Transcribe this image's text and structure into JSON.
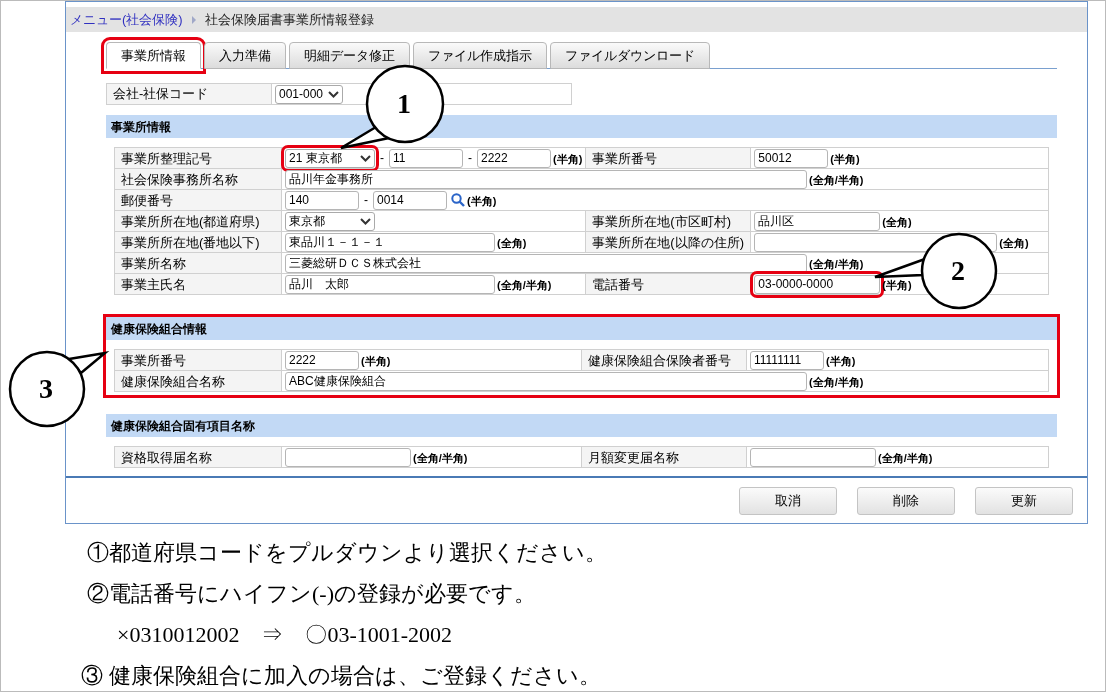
{
  "breadcrumb": {
    "link": "メニュー(社会保険)",
    "current": "社会保険届書事業所情報登録"
  },
  "tabs": [
    {
      "label": "事業所情報",
      "selected": true,
      "highlighted": true
    },
    {
      "label": "入力準備",
      "selected": false,
      "highlighted": false
    },
    {
      "label": "明細データ修正",
      "selected": false,
      "highlighted": false
    },
    {
      "label": "ファイル作成指示",
      "selected": false,
      "highlighted": false
    },
    {
      "label": "ファイルダウンロード",
      "selected": false,
      "highlighted": false
    }
  ],
  "company_code": {
    "label": "会社-社保コード",
    "value": "001-000"
  },
  "sections": [
    {
      "title": "事業所情報",
      "highlighted": false,
      "rows": [
        {
          "cells": [
            {
              "label": "事業所整理記号",
              "items": [
                {
                  "kind": "select",
                  "value": "21 東京都",
                  "highlighted": true
                },
                {
                  "kind": "sep",
                  "text": "-"
                },
                {
                  "kind": "short-input",
                  "value": "11"
                },
                {
                  "kind": "sep",
                  "text": "-"
                },
                {
                  "kind": "short-input",
                  "value": "2222"
                },
                {
                  "kind": "hint",
                  "text": "(半角)"
                }
              ]
            },
            {
              "label": "事業所番号",
              "items": [
                {
                  "kind": "short-input",
                  "value": "50012"
                },
                {
                  "kind": "hint",
                  "text": "(半角)"
                }
              ]
            }
          ]
        },
        {
          "cells": [
            {
              "label": "社会保険事務所名称",
              "items": [
                {
                  "kind": "full-input",
                  "value": "品川年金事務所"
                },
                {
                  "kind": "hint",
                  "text": "(全角/半角)"
                }
              ]
            }
          ]
        },
        {
          "cells": [
            {
              "label": "郵便番号",
              "items": [
                {
                  "kind": "short-input",
                  "value": "140"
                },
                {
                  "kind": "sep",
                  "text": "-"
                },
                {
                  "kind": "short-input",
                  "value": "0014"
                },
                {
                  "kind": "search"
                },
                {
                  "kind": "hint",
                  "text": "(半角)"
                }
              ]
            }
          ]
        },
        {
          "cells": [
            {
              "label": "事業所所在地(都道府県)",
              "items": [
                {
                  "kind": "select",
                  "value": "東京都"
                }
              ]
            },
            {
              "label": "事業所所在地(市区町村)",
              "items": [
                {
                  "kind": "mid-input",
                  "value": "品川区"
                },
                {
                  "kind": "hint",
                  "text": "(全角)"
                }
              ]
            }
          ]
        },
        {
          "cells": [
            {
              "label": "事業所所在地(番地以下)",
              "items": [
                {
                  "kind": "long-input",
                  "value": "東品川１－１－１"
                },
                {
                  "kind": "hint",
                  "text": "(全角)"
                }
              ]
            },
            {
              "label": "事業所所在地(以降の住所)",
              "items": [
                {
                  "kind": "wide-input"
                },
                {
                  "kind": "hint",
                  "text": "(全角)"
                }
              ]
            }
          ]
        },
        {
          "cells": [
            {
              "label": "事業所名称",
              "items": [
                {
                  "kind": "full-input",
                  "value": "三菱総研ＤＣＳ株式会社"
                },
                {
                  "kind": "hint",
                  "text": "(全角/半角)"
                }
              ]
            }
          ]
        },
        {
          "cells": [
            {
              "label": "事業主氏名",
              "items": [
                {
                  "kind": "long-input",
                  "value": "品川　太郎"
                },
                {
                  "kind": "hint",
                  "text": "(全角/半角)"
                }
              ]
            },
            {
              "label": "電話番号",
              "items": [
                {
                  "kind": "mid-input",
                  "value": "03-0000-0000",
                  "highlighted": true
                },
                {
                  "kind": "hint",
                  "text": "(半角)"
                }
              ]
            }
          ]
        }
      ]
    },
    {
      "title": "健康保険組合情報",
      "highlighted": true,
      "rows": [
        {
          "cells": [
            {
              "label": "事業所番号",
              "items": [
                {
                  "kind": "short-input",
                  "value": "2222"
                },
                {
                  "kind": "hint",
                  "text": "(半角)"
                }
              ]
            },
            {
              "label": "健康保険組合保険者番号",
              "items": [
                {
                  "kind": "short-input",
                  "value": "11111111"
                },
                {
                  "kind": "hint",
                  "text": "(半角)"
                }
              ]
            }
          ]
        },
        {
          "cells": [
            {
              "label": "健康保険組合名称",
              "items": [
                {
                  "kind": "full-input",
                  "value": "ABC健康保険組合"
                },
                {
                  "kind": "hint",
                  "text": "(全角/半角)"
                }
              ]
            }
          ]
        }
      ]
    },
    {
      "title": "健康保険組合固有項目名称",
      "highlighted": false,
      "rows": [
        {
          "cells": [
            {
              "label": "資格取得届名称",
              "items": [
                {
                  "kind": "mid-input"
                },
                {
                  "kind": "hint",
                  "text": "(全角/半角)"
                }
              ]
            },
            {
              "label": "月額変更届名称",
              "items": [
                {
                  "kind": "mid-input"
                },
                {
                  "kind": "hint",
                  "text": "(全角/半角)"
                }
              ]
            }
          ]
        }
      ]
    }
  ],
  "buttons": [
    "取消",
    "削除",
    "更新"
  ],
  "callouts": [
    "1",
    "2",
    "3"
  ],
  "notes": [
    {
      "kind": "line",
      "text": "①都道府県コードをプルダウンより選択ください。"
    },
    {
      "kind": "line",
      "text": "②電話番号にハイフン(-)の登録が必要です。"
    },
    {
      "kind": "example",
      "text": "×0310012002　⇒　〇03-1001-2002"
    },
    {
      "kind": "line",
      "text": "③ 健康保険組合に加入の場合は、ご登録ください。"
    }
  ]
}
